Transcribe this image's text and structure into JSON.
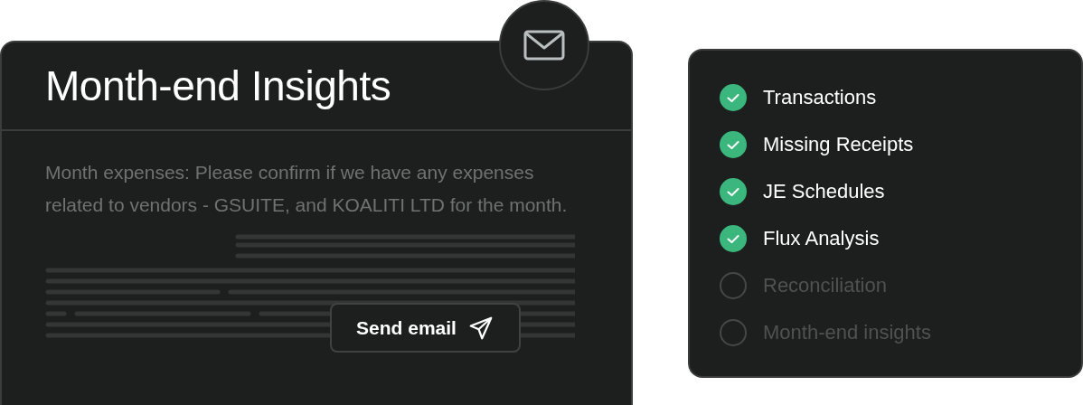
{
  "insights_card": {
    "title": "Month-end Insights",
    "message": "Month expenses: Please confirm if we have any expenses related to vendors - GSUITE, and KOALITI LTD for the month.",
    "send_button": {
      "label": "Send email"
    }
  },
  "checklist": [
    {
      "label": "Transactions",
      "checked": true
    },
    {
      "label": "Missing Receipts",
      "checked": true
    },
    {
      "label": "JE Schedules",
      "checked": true
    },
    {
      "label": "Flux Analysis",
      "checked": true
    },
    {
      "label": "Reconciliation",
      "checked": false
    },
    {
      "label": "Month-end insights",
      "checked": false
    }
  ]
}
